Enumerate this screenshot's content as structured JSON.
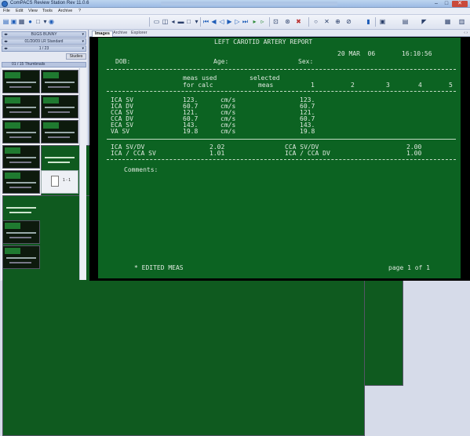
{
  "window": {
    "title": "ComPACS Review Station Rev 11.0.6",
    "min": "–",
    "max": "□",
    "close": "✕"
  },
  "menu": [
    "File",
    "Edit",
    "View",
    "Tools",
    "Archive",
    "?"
  ],
  "left_panel": {
    "patient": "BUGS BUNNY",
    "study_date": "01/20/09 LR Standard",
    "series_counter": "1 / 23",
    "studies_label": "Studies",
    "thumb_header": "01 / 15 Thumbnails"
  },
  "tabs": {
    "items": [
      "Images",
      "Archive",
      "Explorer"
    ],
    "nav": "‹ ›"
  },
  "icons": {
    "new": "doc-icon",
    "save": "save-icon",
    "print": "print-icon",
    "first": "skip-back-icon",
    "prev": "step-back-icon",
    "play": "play-icon",
    "next": "step-forward-icon",
    "last": "skip-forward-icon"
  },
  "colors": {
    "report_bg": "#0c6322",
    "report_text": "#dfe9df",
    "viewer_bg": "#000000"
  },
  "report": {
    "title": "LEFT CAROTID ARTERY REPORT",
    "date": "20 MAR  06",
    "time": "16:10:56",
    "dob_label": "DOB:",
    "age_label": "Age:",
    "sex_label": "Sex:",
    "col_meas_used": "meas used",
    "col_for_calc": "for calc",
    "col_selected": "selected",
    "col_meas": "meas",
    "col_numbers": [
      "1",
      "2",
      "3",
      "4",
      "5"
    ],
    "rows": [
      {
        "name": "ICA SV",
        "value": "123.",
        "unit": "cm/s",
        "selected": "123."
      },
      {
        "name": "ICA DV",
        "value": "60.7",
        "unit": "cm/s",
        "selected": "60.7"
      },
      {
        "name": "CCA SV",
        "value": "121.",
        "unit": "cm/s",
        "selected": "121."
      },
      {
        "name": "CCA DV",
        "value": "60.7",
        "unit": "cm/s",
        "selected": "60.7"
      },
      {
        "name": "ECA SV",
        "value": "143.",
        "unit": "cm/s",
        "selected": "143."
      },
      {
        "name": "VA SV",
        "value": "19.8",
        "unit": "cm/s",
        "selected": "19.8"
      }
    ],
    "ratios": [
      {
        "name": "ICA SV/DV",
        "value": "2.02",
        "name2": "CCA SV/DV",
        "value2": "2.00"
      },
      {
        "name": "ICA / CCA SV",
        "value": "1.01",
        "name2": "ICA / CCA DV",
        "value2": "1.00"
      }
    ],
    "comments_label": "Comments:",
    "footer_note": "* EDITED MEAS",
    "page_label": "page 1 of 1"
  }
}
